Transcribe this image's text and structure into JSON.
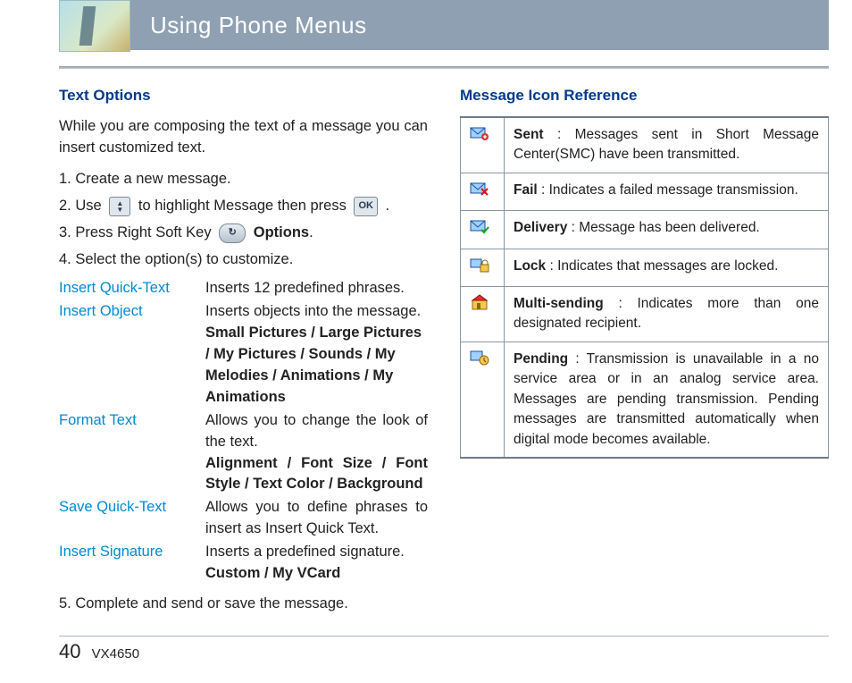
{
  "header": {
    "title": "Using Phone Menus"
  },
  "left": {
    "heading": "Text Options",
    "intro": "While you are composing the text of a message you can insert customized text.",
    "step1": "1.  Create a new message.",
    "step2a": "2.  Use ",
    "step2b": " to highlight Message then press ",
    "step2c": " .",
    "ok_label": "OK",
    "step3a": "3.  Press Right Soft Key ",
    "step3b_bold": "Options",
    "step3c": ".",
    "step4": "4.  Select the option(s) to customize.",
    "opts": {
      "r1l": "Insert Quick-Text",
      "r1d": "Inserts 12 predefined phrases.",
      "r2l": "Insert Object",
      "r2d": "Inserts objects into the message.",
      "r2d2": "Small Pictures / Large Pictures / My Pictures / Sounds / My Melodies / Animations / My Animations",
      "r3l": "Format Text",
      "r3d": "Allows you to change the look of the text.",
      "r3d2": "Alignment / Font Size / Font Style / Text Color / Background",
      "r4l": "Save Quick-Text",
      "r4d": "Allows you to define phrases to insert as Insert Quick Text.",
      "r5l": "Insert Signature",
      "r5d": "Inserts a predefined signature.",
      "r5d2": "Custom / My VCard"
    },
    "step5": "5.  Complete and send or save the message."
  },
  "right": {
    "heading": "Message Icon Reference",
    "rows": [
      {
        "icon": "sent-icon",
        "term": "Sent",
        "sep": " : ",
        "desc": "Messages sent in Short Message Center(SMC) have been transmitted."
      },
      {
        "icon": "fail-icon",
        "term": "Fail",
        "sep": " : ",
        "desc": "Indicates a failed message transmission."
      },
      {
        "icon": "delivery-icon",
        "term": "Delivery",
        "sep": " : ",
        "desc": "Message has been delivered."
      },
      {
        "icon": "lock-icon",
        "term": "Lock",
        "sep": " : ",
        "desc": "Indicates that messages are locked."
      },
      {
        "icon": "multi-icon",
        "term": "Multi-sending",
        "sep": " : ",
        "desc": "Indicates more than one designated recipient."
      },
      {
        "icon": "pending-icon",
        "term": "Pending",
        "sep": " : ",
        "desc": "Transmission is unavailable in a no service area or in an analog service area. Messages are pending transmission. Pending messages are transmitted automatically when digital mode becomes available."
      }
    ]
  },
  "footer": {
    "page": "40",
    "model": "VX4650"
  }
}
